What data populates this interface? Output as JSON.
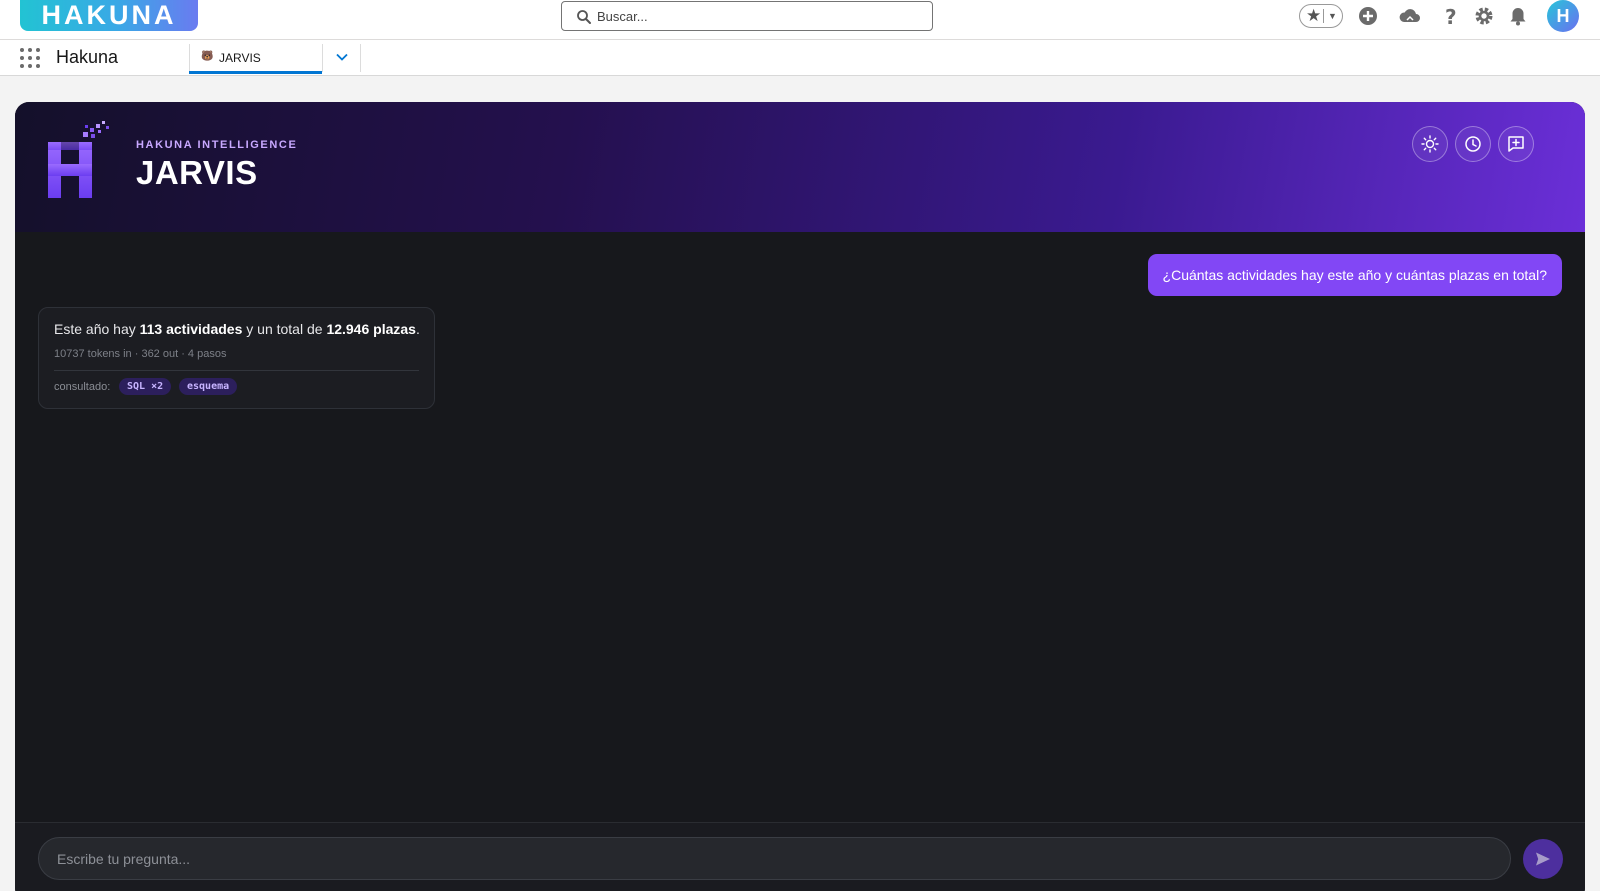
{
  "header": {
    "logo_text": "HAKUNA",
    "search_placeholder": "Buscar...",
    "avatar_letter": "H",
    "icons": [
      "favorites-star-icon",
      "add-icon",
      "cloud-icon",
      "help-icon",
      "gear-icon",
      "bell-icon"
    ]
  },
  "nav": {
    "app_name": "Hakuna",
    "tab": {
      "emoji": "🐻",
      "label": "JARVIS"
    }
  },
  "jarvis": {
    "eyebrow": "HAKUNA INTELLIGENCE",
    "title": "JARVIS",
    "hero_buttons": [
      "theme-toggle-icon",
      "history-icon",
      "new-chat-icon"
    ],
    "messages": {
      "user": "¿Cuántas actividades hay este año y cuántas plazas en total?",
      "assistant": {
        "prefix": "Este año hay",
        "activities": "113 actividades",
        "middle": "y un total de",
        "places": "12.946 plazas",
        "suffix": ".",
        "meta": "10737 tokens in · 362 out · 4 pasos",
        "consulted_label": "consultado:",
        "sources": [
          "SQL ×2",
          "esquema"
        ]
      }
    },
    "composer": {
      "placeholder": "Escribe tu pregunta..."
    }
  },
  "colors": {
    "accent": "#8247f5",
    "hero_start": "#14102a",
    "hero_end": "#6b2fd8",
    "panel_bg": "#17181c",
    "nav_active": "#0176d3"
  }
}
